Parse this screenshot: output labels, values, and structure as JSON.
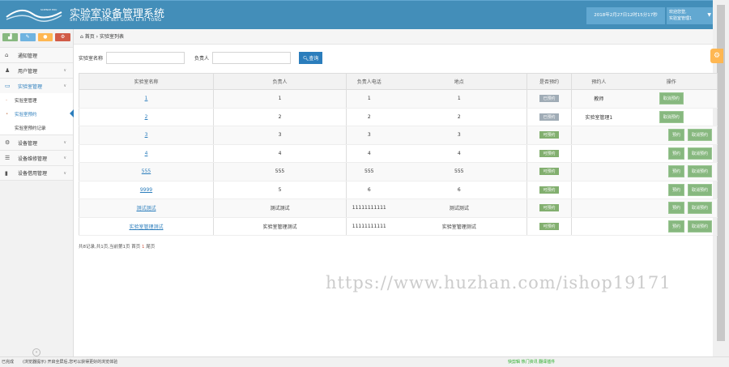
{
  "header": {
    "title": "实验室设备管理系统",
    "subtitle": "SHI YAN SHI SHE BEI GUAN LI XI TONG",
    "logo_text": "SCIENCE EDU",
    "datetime": "2018年2月27日12时15分17秒",
    "welcome": "欢迎您登,",
    "username": "实验室管理1"
  },
  "sidebar": {
    "items": [
      {
        "label": "通知管理",
        "icon": "home-icon"
      },
      {
        "label": "用户管理",
        "icon": "users-icon"
      },
      {
        "label": "实验室管理",
        "icon": "desktop-icon",
        "sub": [
          {
            "label": "实验室管理"
          },
          {
            "label": "实验室预约"
          },
          {
            "label": "实验室预约记录"
          }
        ]
      },
      {
        "label": "设备管理",
        "icon": "cogs-icon"
      },
      {
        "label": "设备维修管理",
        "icon": "list-icon"
      },
      {
        "label": "设备借用管理",
        "icon": "bookmark-icon"
      }
    ]
  },
  "breadcrumb": {
    "home": "首页",
    "current": "实验室列表"
  },
  "search": {
    "name_label": "实验室名称",
    "owner_label": "负责人",
    "button": "查询"
  },
  "table": {
    "headers": [
      "实验室名称",
      "负责人",
      "负责人电话",
      "地点",
      "是否预约",
      "预约人",
      "操作"
    ],
    "rows": [
      {
        "name": "1",
        "owner": "1",
        "phone": "1",
        "location": "1",
        "status": "已预约",
        "booker": "教师",
        "booked": true
      },
      {
        "name": "2",
        "owner": "2",
        "phone": "2",
        "location": "2",
        "status": "已预约",
        "booker": "实验室管理1",
        "booked": true
      },
      {
        "name": "3",
        "owner": "3",
        "phone": "3",
        "location": "3",
        "status": "可预约",
        "booker": "",
        "booked": false
      },
      {
        "name": "4",
        "owner": "4",
        "phone": "4",
        "location": "4",
        "status": "可预约",
        "booker": "",
        "booked": false
      },
      {
        "name": "555",
        "owner": "555",
        "phone": "555",
        "location": "555",
        "status": "可预约",
        "booker": "",
        "booked": false
      },
      {
        "name": "9999",
        "owner": "5",
        "phone": "6",
        "location": "6",
        "status": "可预约",
        "booker": "",
        "booked": false
      },
      {
        "name": "测试测试",
        "owner": "测试测试",
        "phone": "11111111111",
        "location": "测试测试",
        "status": "可预约",
        "booker": "",
        "booked": false
      },
      {
        "name": "实验室管理测试",
        "owner": "实验室管理测试",
        "phone": "11111111111",
        "location": "实验室管理测试",
        "status": "可预约",
        "booker": "",
        "booked": false
      }
    ],
    "book_label": "预约",
    "cancel_label": "取消预约"
  },
  "pager": {
    "summary": "共8记录,共1页,当前第1页 首页",
    "current": "1",
    "last": "尾页"
  },
  "watermark": "https://www.huzhan.com/ishop19171",
  "statusbar": {
    "left": "已完成",
    "middle": "(浏览器提示) 开启全屏后,您可以获得更好的浏览体验",
    "right": "快剪辑  热门资讯  翻译插件"
  }
}
